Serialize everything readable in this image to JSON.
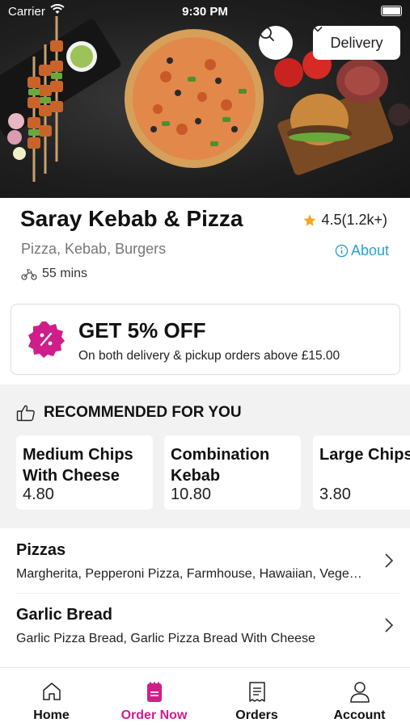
{
  "status_bar": {
    "carrier": "Carrier",
    "time": "9:30 PM"
  },
  "header": {
    "delivery_label": "Delivery"
  },
  "restaurant": {
    "name": "Saray Kebab & Pizza",
    "rating": "4.5(1.2k+)",
    "cuisines": "Pizza, Kebab, Burgers",
    "about_label": "About",
    "delivery_time": "55 mins"
  },
  "offer": {
    "title": "GET 5% OFF",
    "subtitle": "On both delivery & pickup orders above £15.00"
  },
  "recommended": {
    "heading": "RECOMMENDED FOR YOU",
    "items": [
      {
        "name": "Medium Chips With Cheese",
        "price": "4.80"
      },
      {
        "name": "Combination Kebab",
        "price": "10.80"
      },
      {
        "name": "Large Chips",
        "price": "3.80"
      }
    ]
  },
  "categories": [
    {
      "title": "Pizzas",
      "description": "Margherita, Pepperoni Pizza, Farmhouse, Hawaiian, Vegetarian"
    },
    {
      "title": "Garlic Bread",
      "description": "Garlic Pizza Bread, Garlic Pizza Bread With Cheese"
    }
  ],
  "tabbar": {
    "tabs": [
      {
        "label": "Home",
        "icon": "home-icon"
      },
      {
        "label": "Order Now",
        "icon": "order-bag-icon"
      },
      {
        "label": "Orders",
        "icon": "receipt-icon"
      },
      {
        "label": "Account",
        "icon": "person-icon"
      }
    ],
    "active_index": 1
  },
  "colors": {
    "accent": "#cf1e8a",
    "link": "#2a9fd6",
    "star": "#f5a623"
  }
}
